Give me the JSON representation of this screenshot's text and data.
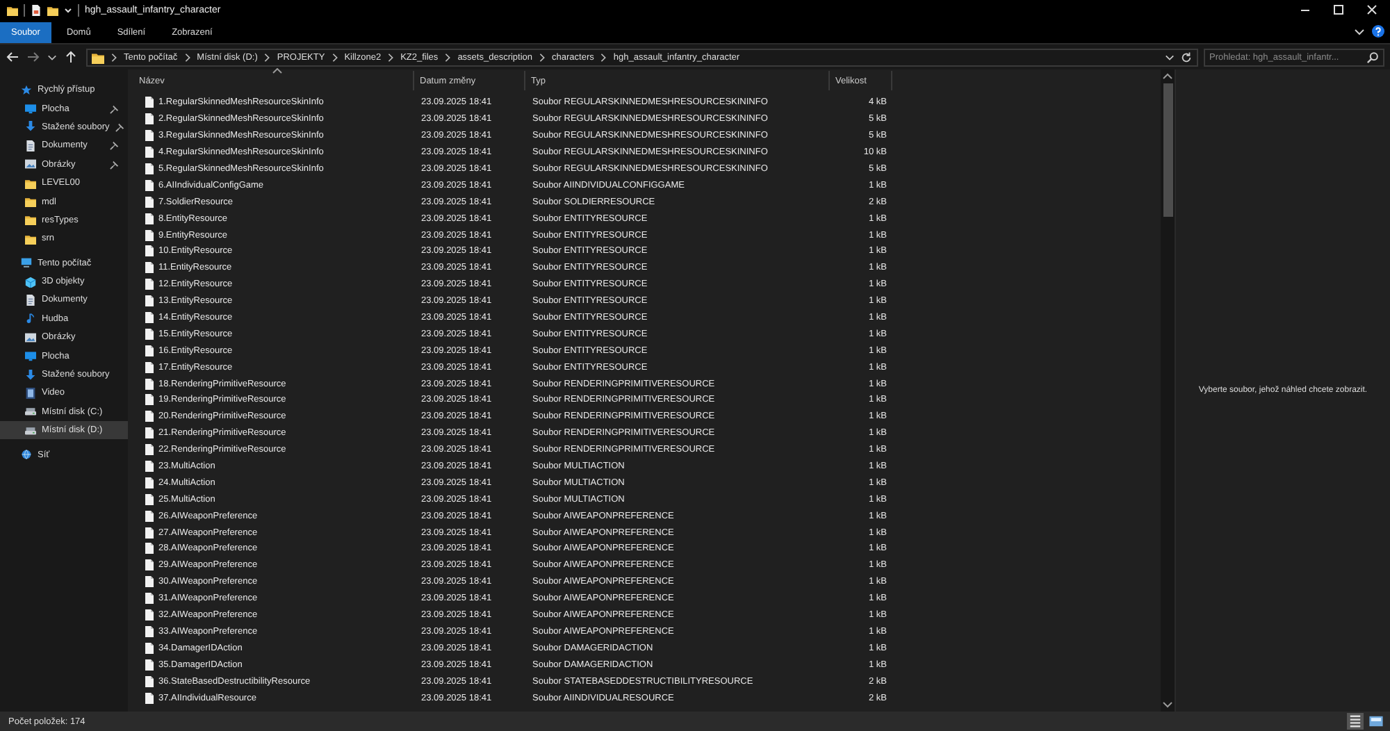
{
  "window": {
    "title": "hgh_assault_infantry_character"
  },
  "ribbon_tabs": [
    {
      "label": "Soubor",
      "selected": true
    },
    {
      "label": "Domů",
      "selected": false
    },
    {
      "label": "Sdílení",
      "selected": false
    },
    {
      "label": "Zobrazení",
      "selected": false
    }
  ],
  "address_bar": {
    "path": [
      "Tento počítač",
      "Místní disk (D:)",
      "PROJEKTY",
      "Killzone2",
      "KZ2_files",
      "assets_description",
      "characters",
      "hgh_assault_infantry_character"
    ]
  },
  "search": {
    "placeholder": "Prohledat: hgh_assault_infantr..."
  },
  "sidebar": {
    "items": [
      {
        "label": "Rychlý přístup",
        "kind": "star",
        "selected": false,
        "children": [
          {
            "label": "Plocha",
            "kind": "desktop",
            "pinned": true,
            "selected": false
          },
          {
            "label": "Stažené soubory",
            "kind": "download",
            "pinned": true,
            "selected": false
          },
          {
            "label": "Dokumenty",
            "kind": "document",
            "pinned": true,
            "selected": false
          },
          {
            "label": "Obrázky",
            "kind": "picture",
            "pinned": true,
            "selected": false
          },
          {
            "label": "LEVEL00",
            "kind": "folder",
            "pinned": false,
            "selected": false
          },
          {
            "label": "mdl",
            "kind": "folder",
            "pinned": false,
            "selected": false
          },
          {
            "label": "resTypes",
            "kind": "folder",
            "pinned": false,
            "selected": false
          },
          {
            "label": "srn",
            "kind": "folder",
            "pinned": false,
            "selected": false
          }
        ]
      },
      {
        "label": "Tento počítač",
        "kind": "pc",
        "selected": false,
        "children": [
          {
            "label": "3D objekty",
            "kind": "cube",
            "selected": false
          },
          {
            "label": "Dokumenty",
            "kind": "document",
            "selected": false
          },
          {
            "label": "Hudba",
            "kind": "music",
            "selected": false
          },
          {
            "label": "Obrázky",
            "kind": "picture",
            "selected": false
          },
          {
            "label": "Plocha",
            "kind": "desktop",
            "selected": false
          },
          {
            "label": "Stažené soubory",
            "kind": "download",
            "selected": false
          },
          {
            "label": "Video",
            "kind": "video",
            "selected": false
          },
          {
            "label": "Místní disk (C:)",
            "kind": "drive",
            "selected": false
          },
          {
            "label": "Místní disk (D:)",
            "kind": "drive",
            "selected": true
          }
        ]
      },
      {
        "label": "Síť",
        "kind": "network",
        "selected": false
      }
    ]
  },
  "file_list": {
    "columns": [
      {
        "label": "Název",
        "sorted": true
      },
      {
        "label": "Datum změny",
        "sorted": false
      },
      {
        "label": "Typ",
        "sorted": false
      },
      {
        "label": "Velikost",
        "sorted": false
      }
    ],
    "rows": [
      {
        "name": "1.RegularSkinnedMeshResourceSkinInfo",
        "modified": "23.09.2025 18:41",
        "type": "Soubor REGULARSKINNEDMESHRESOURCESKININFO",
        "size": "4 kB"
      },
      {
        "name": "2.RegularSkinnedMeshResourceSkinInfo",
        "modified": "23.09.2025 18:41",
        "type": "Soubor REGULARSKINNEDMESHRESOURCESKININFO",
        "size": "5 kB"
      },
      {
        "name": "3.RegularSkinnedMeshResourceSkinInfo",
        "modified": "23.09.2025 18:41",
        "type": "Soubor REGULARSKINNEDMESHRESOURCESKININFO",
        "size": "5 kB"
      },
      {
        "name": "4.RegularSkinnedMeshResourceSkinInfo",
        "modified": "23.09.2025 18:41",
        "type": "Soubor REGULARSKINNEDMESHRESOURCESKININFO",
        "size": "10 kB"
      },
      {
        "name": "5.RegularSkinnedMeshResourceSkinInfo",
        "modified": "23.09.2025 18:41",
        "type": "Soubor REGULARSKINNEDMESHRESOURCESKININFO",
        "size": "5 kB"
      },
      {
        "name": "6.AIIndividualConfigGame",
        "modified": "23.09.2025 18:41",
        "type": "Soubor AIINDIVIDUALCONFIGGAME",
        "size": "1 kB"
      },
      {
        "name": "7.SoldierResource",
        "modified": "23.09.2025 18:41",
        "type": "Soubor SOLDIERRESOURCE",
        "size": "2 kB"
      },
      {
        "name": "8.EntityResource",
        "modified": "23.09.2025 18:41",
        "type": "Soubor ENTITYRESOURCE",
        "size": "1 kB"
      },
      {
        "name": "9.EntityResource",
        "modified": "23.09.2025 18:41",
        "type": "Soubor ENTITYRESOURCE",
        "size": "1 kB"
      },
      {
        "name": "10.EntityResource",
        "modified": "23.09.2025 18:41",
        "type": "Soubor ENTITYRESOURCE",
        "size": "1 kB"
      },
      {
        "name": "11.EntityResource",
        "modified": "23.09.2025 18:41",
        "type": "Soubor ENTITYRESOURCE",
        "size": "1 kB"
      },
      {
        "name": "12.EntityResource",
        "modified": "23.09.2025 18:41",
        "type": "Soubor ENTITYRESOURCE",
        "size": "1 kB"
      },
      {
        "name": "13.EntityResource",
        "modified": "23.09.2025 18:41",
        "type": "Soubor ENTITYRESOURCE",
        "size": "1 kB"
      },
      {
        "name": "14.EntityResource",
        "modified": "23.09.2025 18:41",
        "type": "Soubor ENTITYRESOURCE",
        "size": "1 kB"
      },
      {
        "name": "15.EntityResource",
        "modified": "23.09.2025 18:41",
        "type": "Soubor ENTITYRESOURCE",
        "size": "1 kB"
      },
      {
        "name": "16.EntityResource",
        "modified": "23.09.2025 18:41",
        "type": "Soubor ENTITYRESOURCE",
        "size": "1 kB"
      },
      {
        "name": "17.EntityResource",
        "modified": "23.09.2025 18:41",
        "type": "Soubor ENTITYRESOURCE",
        "size": "1 kB"
      },
      {
        "name": "18.RenderingPrimitiveResource",
        "modified": "23.09.2025 18:41",
        "type": "Soubor RENDERINGPRIMITIVERESOURCE",
        "size": "1 kB"
      },
      {
        "name": "19.RenderingPrimitiveResource",
        "modified": "23.09.2025 18:41",
        "type": "Soubor RENDERINGPRIMITIVERESOURCE",
        "size": "1 kB"
      },
      {
        "name": "20.RenderingPrimitiveResource",
        "modified": "23.09.2025 18:41",
        "type": "Soubor RENDERINGPRIMITIVERESOURCE",
        "size": "1 kB"
      },
      {
        "name": "21.RenderingPrimitiveResource",
        "modified": "23.09.2025 18:41",
        "type": "Soubor RENDERINGPRIMITIVERESOURCE",
        "size": "1 kB"
      },
      {
        "name": "22.RenderingPrimitiveResource",
        "modified": "23.09.2025 18:41",
        "type": "Soubor RENDERINGPRIMITIVERESOURCE",
        "size": "1 kB"
      },
      {
        "name": "23.MultiAction",
        "modified": "23.09.2025 18:41",
        "type": "Soubor MULTIACTION",
        "size": "1 kB"
      },
      {
        "name": "24.MultiAction",
        "modified": "23.09.2025 18:41",
        "type": "Soubor MULTIACTION",
        "size": "1 kB"
      },
      {
        "name": "25.MultiAction",
        "modified": "23.09.2025 18:41",
        "type": "Soubor MULTIACTION",
        "size": "1 kB"
      },
      {
        "name": "26.AIWeaponPreference",
        "modified": "23.09.2025 18:41",
        "type": "Soubor AIWEAPONPREFERENCE",
        "size": "1 kB"
      },
      {
        "name": "27.AIWeaponPreference",
        "modified": "23.09.2025 18:41",
        "type": "Soubor AIWEAPONPREFERENCE",
        "size": "1 kB"
      },
      {
        "name": "28.AIWeaponPreference",
        "modified": "23.09.2025 18:41",
        "type": "Soubor AIWEAPONPREFERENCE",
        "size": "1 kB"
      },
      {
        "name": "29.AIWeaponPreference",
        "modified": "23.09.2025 18:41",
        "type": "Soubor AIWEAPONPREFERENCE",
        "size": "1 kB"
      },
      {
        "name": "30.AIWeaponPreference",
        "modified": "23.09.2025 18:41",
        "type": "Soubor AIWEAPONPREFERENCE",
        "size": "1 kB"
      },
      {
        "name": "31.AIWeaponPreference",
        "modified": "23.09.2025 18:41",
        "type": "Soubor AIWEAPONPREFERENCE",
        "size": "1 kB"
      },
      {
        "name": "32.AIWeaponPreference",
        "modified": "23.09.2025 18:41",
        "type": "Soubor AIWEAPONPREFERENCE",
        "size": "1 kB"
      },
      {
        "name": "33.AIWeaponPreference",
        "modified": "23.09.2025 18:41",
        "type": "Soubor AIWEAPONPREFERENCE",
        "size": "1 kB"
      },
      {
        "name": "34.DamagerIDAction",
        "modified": "23.09.2025 18:41",
        "type": "Soubor DAMAGERIDACTION",
        "size": "1 kB"
      },
      {
        "name": "35.DamagerIDAction",
        "modified": "23.09.2025 18:41",
        "type": "Soubor DAMAGERIDACTION",
        "size": "1 kB"
      },
      {
        "name": "36.StateBasedDestructibilityResource",
        "modified": "23.09.2025 18:41",
        "type": "Soubor STATEBASEDDESTRUCTIBILITYRESOURCE",
        "size": "2 kB"
      },
      {
        "name": "37.AIIndividualResource",
        "modified": "23.09.2025 18:41",
        "type": "Soubor AIINDIVIDUALRESOURCE",
        "size": "2 kB"
      }
    ]
  },
  "preview_pane": {
    "message": "Vyberte soubor, jehož náhled chcete zobrazit."
  },
  "status_bar": {
    "item_count": "Počet položek: 174",
    "view_buttons": [
      {
        "kind": "details",
        "selected": true
      },
      {
        "kind": "large-icons",
        "selected": false
      }
    ]
  }
}
